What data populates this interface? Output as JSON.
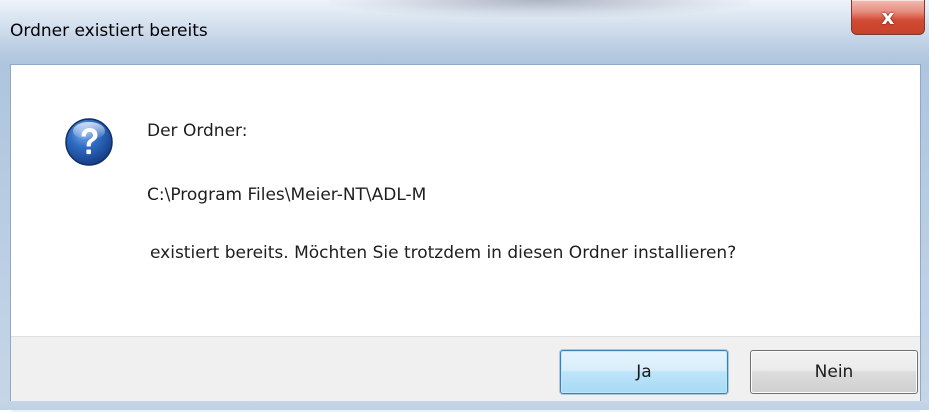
{
  "window": {
    "title": "Ordner existiert bereits",
    "close_glyph": "x"
  },
  "message": {
    "icon": "question-icon",
    "line1": "Der Ordner:",
    "path": "C:\\Program Files\\Meier-NT\\ADL-M",
    "line3": " existiert bereits. Möchten Sie trotzdem in diesen Ordner installieren?"
  },
  "buttons": {
    "yes_label": "Ja",
    "no_label": "Nein"
  },
  "colors": {
    "title_bar": "#c9d8e9",
    "close_button": "#d14a33",
    "button_area": "#f0f0f0",
    "default_button_border": "#3c7fb1"
  }
}
